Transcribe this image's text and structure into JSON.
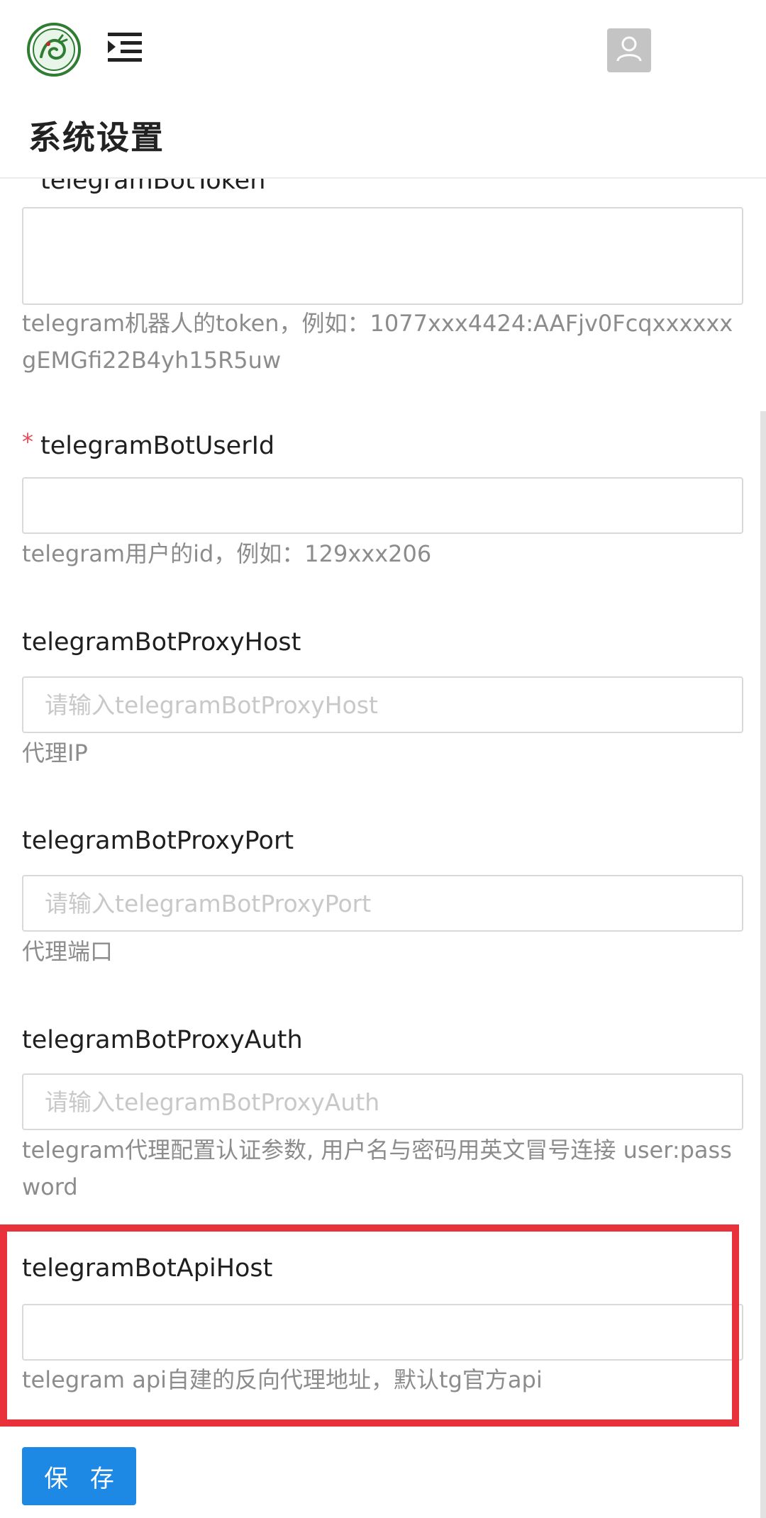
{
  "header": {
    "page_title": "系统设置"
  },
  "form": {
    "bot_token": {
      "label": "telegramBotToken",
      "value": "",
      "help": "telegram机器人的token，例如：1077xxx4424:AAFjv0FcqxxxxxxgEMGfi22B4yh15R5uw"
    },
    "bot_user_id": {
      "required_mark": "*",
      "label": "telegramBotUserId",
      "value": "",
      "help": "telegram用户的id，例如：129xxx206"
    },
    "proxy_host": {
      "label": "telegramBotProxyHost",
      "placeholder": "请输入telegramBotProxyHost",
      "help": "代理IP"
    },
    "proxy_port": {
      "label": "telegramBotProxyPort",
      "placeholder": "请输入telegramBotProxyPort",
      "help": "代理端口"
    },
    "proxy_auth": {
      "label": "telegramBotProxyAuth",
      "placeholder": "请输入telegramBotProxyAuth",
      "help": "telegram代理配置认证参数, 用户名与密码用英文冒号连接 user:password"
    },
    "api_host": {
      "label": "telegramBotApiHost",
      "value": "",
      "help": "telegram api自建的反向代理地址，默认tg官方api"
    }
  },
  "actions": {
    "save_label": "保 存"
  },
  "colors": {
    "accent": "#1e88e5",
    "highlight": "#e8313a",
    "required": "#e34d59"
  },
  "icons": {
    "logo": "dragon-logo-icon",
    "menu": "menu-toggle-icon",
    "avatar": "user-avatar-icon"
  }
}
